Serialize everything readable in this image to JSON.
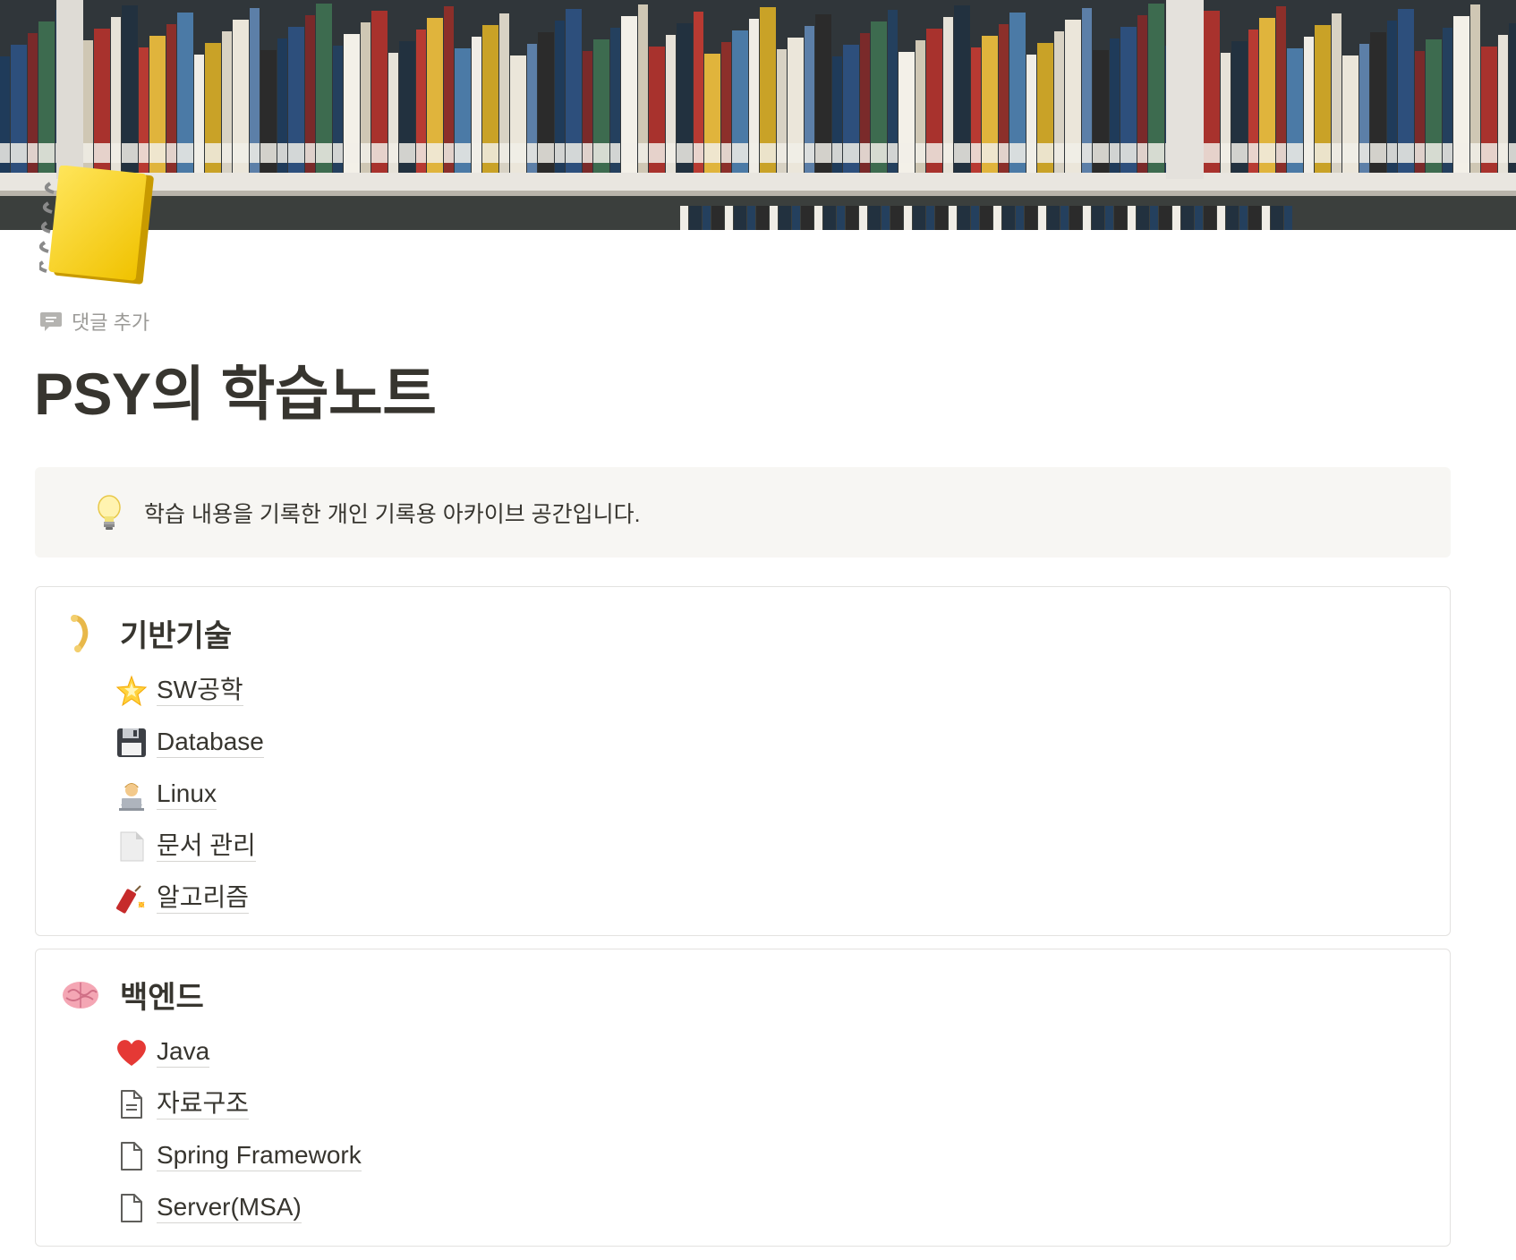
{
  "page": {
    "title": "PSY의 학습노트",
    "add_comment": "댓글 추가",
    "cover_image": "bookshelf-photo",
    "page_icon": "notebook-icon"
  },
  "callout": {
    "icon": "lightbulb-icon",
    "text": "학습 내용을 기록한 개인 기록용 아카이브 공간입니다."
  },
  "sections": [
    {
      "title": "기반기술",
      "icon": "bone-icon",
      "items": [
        {
          "label": "SW공학",
          "icon": "glowing-star-icon"
        },
        {
          "label": "Database",
          "icon": "floppy-disk-icon"
        },
        {
          "label": "Linux",
          "icon": "technologist-icon"
        },
        {
          "label": "문서 관리",
          "icon": "page-icon"
        },
        {
          "label": "알고리즘",
          "icon": "firecracker-icon"
        }
      ]
    },
    {
      "title": "백엔드",
      "icon": "brain-icon",
      "items": [
        {
          "label": "Java",
          "icon": "red-heart-icon"
        },
        {
          "label": "자료구조",
          "icon": "document-text-icon"
        },
        {
          "label": "Spring Framework",
          "icon": "document-icon"
        },
        {
          "label": "Server(MSA)",
          "icon": "document-icon"
        }
      ]
    }
  ],
  "colors": {
    "text": "#37352f",
    "muted": "#9b9a97",
    "callout_bg": "#f7f6f3",
    "border": "#e3e2e0"
  }
}
